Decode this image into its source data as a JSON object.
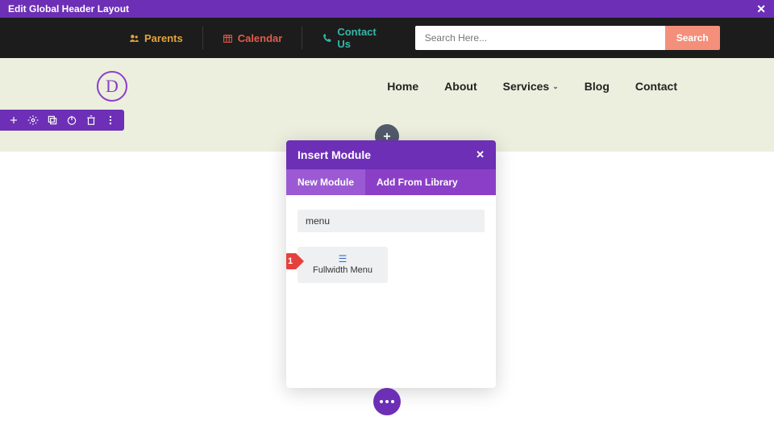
{
  "topbar": {
    "title": "Edit Global Header Layout",
    "close": "✕"
  },
  "utility": {
    "parents": {
      "label": "Parents"
    },
    "calendar": {
      "label": "Calendar"
    },
    "contact": {
      "label": "Contact Us"
    },
    "search_placeholder": "Search Here...",
    "search_button": "Search"
  },
  "logo": {
    "letter": "D"
  },
  "nav": {
    "home": "Home",
    "about": "About",
    "services": "Services",
    "blog": "Blog",
    "contact": "Contact"
  },
  "modal": {
    "title": "Insert Module",
    "tabs": {
      "new": "New Module",
      "library": "Add From Library"
    },
    "search_value": "menu",
    "results": [
      {
        "label": "Fullwidth Menu"
      }
    ],
    "step_badge": "1"
  }
}
